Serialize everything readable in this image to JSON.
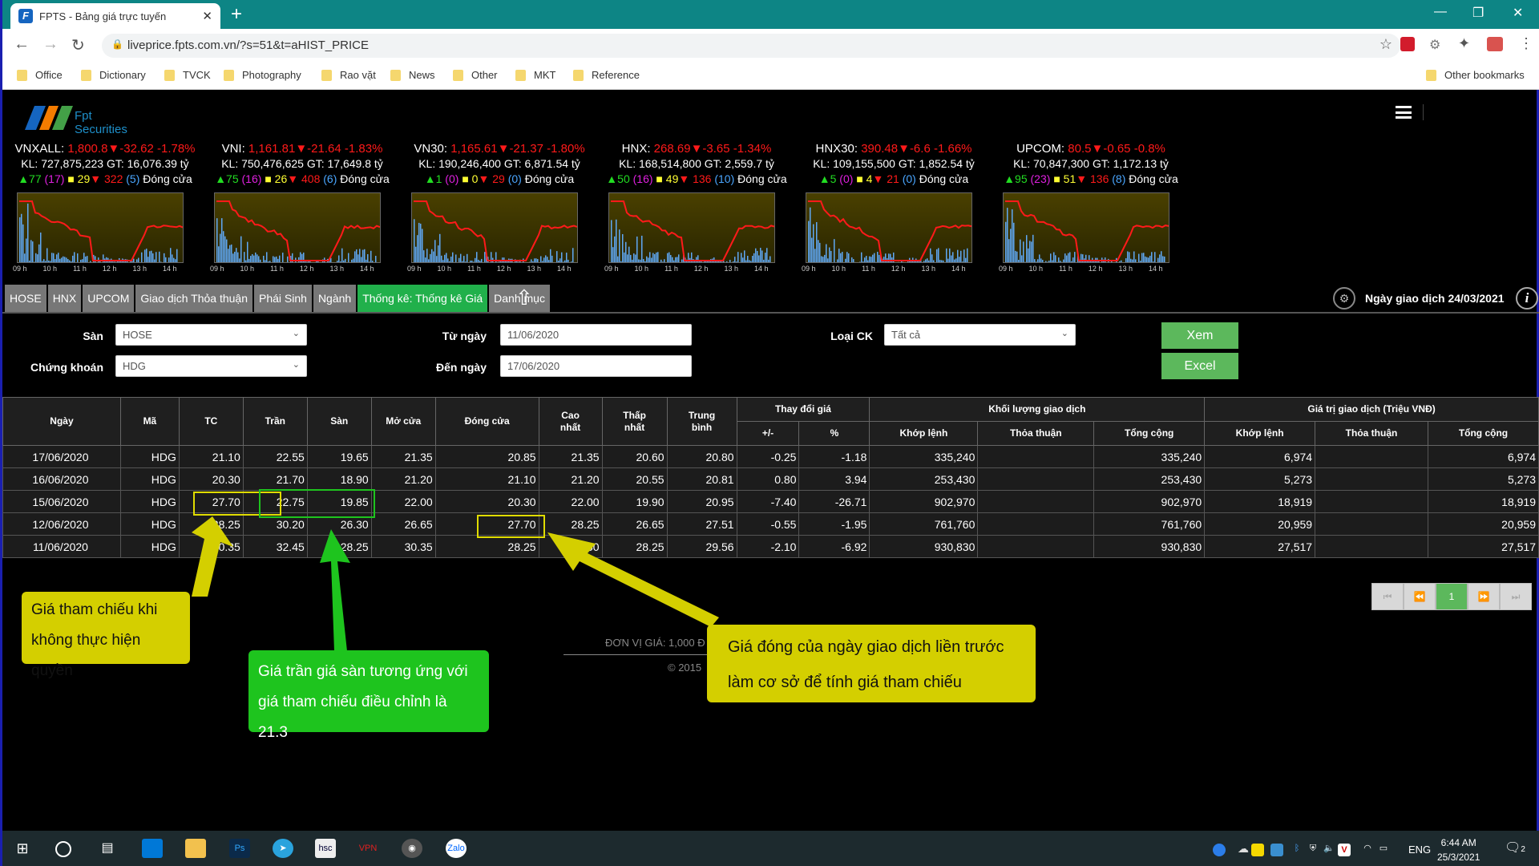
{
  "browser": {
    "tab_title": "FPTS - Bảng giá trực tuyến",
    "url": "liveprice.fpts.com.vn/?s=51&t=aHIST_PRICE",
    "bookmarks": [
      "Office",
      "Dictionary",
      "TVCK",
      "Photography",
      "Rao vặt",
      "News",
      "Other",
      "MKT",
      "Reference"
    ],
    "other_bookmarks": "Other bookmarks"
  },
  "header": {
    "logo_text": "Fpt Securities"
  },
  "indices": [
    {
      "name": "VNXALL:",
      "value": "1,800.8",
      "change": "-32.62",
      "pct": "-1.78%",
      "kl": "KL: 727,875,223 GT: 16,076.39 tỷ",
      "up": "77",
      "ceil": "(17)",
      "ref": "29",
      "down": "322",
      "floor": "(5)",
      "status": "Đóng cửa"
    },
    {
      "name": "VNI:",
      "value": "1,161.81",
      "change": "-21.64",
      "pct": "-1.83%",
      "kl": "KL: 750,476,625 GT: 17,649.8 tỷ",
      "up": "75",
      "ceil": "(16)",
      "ref": "26",
      "down": "408",
      "floor": "(6)",
      "status": "Đóng cửa"
    },
    {
      "name": "VN30:",
      "value": "1,165.61",
      "change": "-21.37",
      "pct": "-1.80%",
      "kl": "KL: 190,246,400 GT: 6,871.54 tỷ",
      "up": "1",
      "ceil": "(0)",
      "ref": "0",
      "down": "29",
      "floor": "(0)",
      "status": "Đóng cửa"
    },
    {
      "name": "HNX:",
      "value": "268.69",
      "change": "-3.65",
      "pct": "-1.34%",
      "kl": "KL: 168,514,800 GT: 2,559.7 tỷ",
      "up": "50",
      "ceil": "(16)",
      "ref": "49",
      "down": "136",
      "floor": "(10)",
      "status": "Đóng cửa"
    },
    {
      "name": "HNX30:",
      "value": "390.48",
      "change": "-6.6",
      "pct": "-1.66%",
      "kl": "KL: 109,155,500 GT: 1,852.54 tỷ",
      "up": "5",
      "ceil": "(0)",
      "ref": "4",
      "down": "21",
      "floor": "(0)",
      "status": "Đóng cửa"
    },
    {
      "name": "UPCOM:",
      "value": "80.5",
      "change": "-0.65",
      "pct": "-0.8%",
      "kl": "KL: 70,847,300 GT: 1,172.13 tỷ",
      "up": "95",
      "ceil": "(23)",
      "ref": "51",
      "down": "136",
      "floor": "(8)",
      "status": "Đóng cửa"
    }
  ],
  "chart_hours": [
    "09 h",
    "10 h",
    "11 h",
    "12 h",
    "13 h",
    "14 h"
  ],
  "tabs": [
    "HOSE",
    "HNX",
    "UPCOM",
    "Giao dịch Thỏa thuận",
    "Phái Sinh",
    "Ngành",
    "Thống kê: Thống kê Giá",
    "Danh mục"
  ],
  "active_tab": "Thống kê: Thống kê Giá",
  "trade_date": "Ngày giao dịch 24/03/2021",
  "form": {
    "san_label": "Sàn",
    "san_value": "HOSE",
    "ck_label": "Chứng khoán",
    "ck_value": "HDG",
    "from_label": "Từ ngày",
    "from_value": "11/06/2020",
    "to_label": "Đến ngày",
    "to_value": "17/06/2020",
    "type_label": "Loại CK",
    "type_value": "Tất cả",
    "view_btn": "Xem",
    "excel_btn": "Excel"
  },
  "table": {
    "headers": {
      "date": "Ngày",
      "code": "Mã",
      "ref": "TC",
      "ceil": "Trần",
      "floor": "Sàn",
      "open": "Mở cửa",
      "close": "Đóng cửa",
      "high": "Cao nhất",
      "low": "Thấp nhất",
      "avg": "Trung bình",
      "change_group": "Thay đổi giá",
      "chg": "+/-",
      "pct": "%",
      "vol_group": "Khối lượng giao dịch",
      "val_group": "Giá trị giao dịch (Triệu VNĐ)",
      "match": "Khớp lệnh",
      "deal": "Thỏa thuận",
      "total": "Tổng cộng"
    },
    "rows": [
      [
        "17/06/2020",
        "HDG",
        "21.10",
        "22.55",
        "19.65",
        "21.35",
        "20.85",
        "21.35",
        "20.60",
        "20.80",
        "-0.25",
        "-1.18",
        "335,240",
        "",
        "335,240",
        "6,974",
        "",
        "6,974"
      ],
      [
        "16/06/2020",
        "HDG",
        "20.30",
        "21.70",
        "18.90",
        "21.20",
        "21.10",
        "21.20",
        "20.55",
        "20.81",
        "0.80",
        "3.94",
        "253,430",
        "",
        "253,430",
        "5,273",
        "",
        "5,273"
      ],
      [
        "15/06/2020",
        "HDG",
        "27.70",
        "22.75",
        "19.85",
        "22.00",
        "20.30",
        "22.00",
        "19.90",
        "20.95",
        "-7.40",
        "-26.71",
        "902,970",
        "",
        "902,970",
        "18,919",
        "",
        "18,919"
      ],
      [
        "12/06/2020",
        "HDG",
        "28.25",
        "30.20",
        "26.30",
        "26.65",
        "27.70",
        "28.25",
        "26.65",
        "27.51",
        "-0.55",
        "-1.95",
        "761,760",
        "",
        "761,760",
        "20,959",
        "",
        "20,959"
      ],
      [
        "11/06/2020",
        "HDG",
        "30.35",
        "32.45",
        "28.25",
        "30.35",
        "28.25",
        "30.50",
        "28.25",
        "29.56",
        "-2.10",
        "-6.92",
        "930,830",
        "",
        "930,830",
        "27,517",
        "",
        "27,517"
      ]
    ]
  },
  "pager": {
    "current": "1"
  },
  "footer": {
    "unit": "ĐƠN VỊ GIÁ: 1,000 Đ",
    "copyright": "© 2015"
  },
  "annotations": {
    "ref_note": "Giá tham chiếu khi không thực hiện quyền",
    "ceil_floor_note": "Giá trần giá sàn tương ứng với giá tham chiếu điều chỉnh là 21.3",
    "close_note": "Giá đóng của ngày giao dịch liền trước làm cơ sở để tính giá tham chiếu"
  },
  "taskbar": {
    "lang": "ENG",
    "time": "6:44 AM",
    "date": "25/3/2021",
    "notifications": "2"
  },
  "colors": {
    "up": "#22dd22",
    "down": "#ff1a1a",
    "ceiling": "#e020e0",
    "ref": "#ffff33",
    "floor": "#4aa6ff",
    "active_tab": "#21b04b",
    "button": "#5cb85c",
    "note_yellow": "#d4cf00",
    "note_green": "#1ec41e"
  }
}
